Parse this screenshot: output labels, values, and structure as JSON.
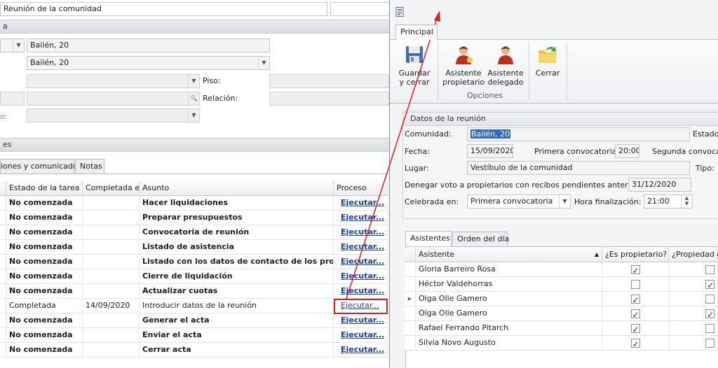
{
  "left": {
    "top_title": "Reunión de la comunidad",
    "section1_title": "a",
    "address1": "Bailén, 20",
    "address2": "Bailén, 20",
    "piso_label": "Piso:",
    "relacion_label": "Relación:",
    "cut_label": "o:",
    "section2_title": "es",
    "tabs": [
      "iones y comunicados",
      "Notas"
    ],
    "grid_headers": [
      "Estado de la tarea",
      "Completada el",
      "Asunto",
      "Proceso"
    ],
    "rows": [
      {
        "estado": "No comenzada",
        "fecha": "",
        "asunto": "Hacer liquidaciones",
        "proceso": "Ejecutar...",
        "bold": true
      },
      {
        "estado": "No comenzada",
        "fecha": "",
        "asunto": "Preparar presupuestos",
        "proceso": "Ejecutar...",
        "bold": true
      },
      {
        "estado": "No comenzada",
        "fecha": "",
        "asunto": "Convocatoria de reunión",
        "proceso": "Ejecutar...",
        "bold": true
      },
      {
        "estado": "No comenzada",
        "fecha": "",
        "asunto": "Listado de asistencia",
        "proceso": "Ejecutar...",
        "bold": true
      },
      {
        "estado": "No comenzada",
        "fecha": "",
        "asunto": "Listado con los datos de contacto de los propi...",
        "proceso": "Ejecutar...",
        "bold": true
      },
      {
        "estado": "No comenzada",
        "fecha": "",
        "asunto": "Cierre de liquidación",
        "proceso": "Ejecutar...",
        "bold": true
      },
      {
        "estado": "No comenzada",
        "fecha": "",
        "asunto": "Actualizar cuotas",
        "proceso": "Ejecutar...",
        "bold": true
      },
      {
        "estado": "Completada",
        "fecha": "14/09/2020",
        "asunto": "Introducir datos de la reunión",
        "proceso": "Ejecutar...",
        "bold": false
      },
      {
        "estado": "No comenzada",
        "fecha": "",
        "asunto": "Generar el acta",
        "proceso": "Ejecutar...",
        "bold": true
      },
      {
        "estado": "No comenzada",
        "fecha": "",
        "asunto": "Enviar el acta",
        "proceso": "Ejecutar...",
        "bold": true
      },
      {
        "estado": "No comenzada",
        "fecha": "",
        "asunto": "Cerrar acta",
        "proceso": "Ejecutar...",
        "bold": true
      }
    ]
  },
  "dialog": {
    "ribbon_tab": "Principal",
    "buttons": {
      "save": "Guardar\ny cerrar",
      "owner": "Asistente\npropietario",
      "delegate": "Asistente\ndelegado",
      "close": "Cerrar"
    },
    "group_label": "Opciones",
    "section_title": "Datos de la reunión",
    "comunidad_label": "Comunidad:",
    "comunidad_value": "Bailén, 20",
    "estado_label": "Estado:",
    "fecha_label": "Fecha:",
    "fecha_value": "15/09/2020",
    "primera_label": "Primera convocatoria:",
    "primera_value": "20:00",
    "segunda_label": "Segunda convocato",
    "lugar_label": "Lugar:",
    "lugar_value": "Vestíbulo de la comunidad",
    "tipo_label": "Tipo:",
    "denegar_label": "Denegar voto a propietarios con recibos pendientes anteriores a:",
    "denegar_value": "31/12/2020",
    "celebrada_label": "Celebrada en:",
    "celebrada_value": "Primera convocatoria",
    "hora_label": "Hora finalización:",
    "hora_value": "21:00",
    "tabs": [
      "Asistentes",
      "Orden del día"
    ],
    "att_headers": [
      "Asistente",
      "¿Es propietario?",
      "¿Propiedad de"
    ],
    "attendees": [
      {
        "name": "Gloria Barreiro Rosa",
        "owner": true,
        "prop": false
      },
      {
        "name": "Héctor Valdehorras",
        "owner": false,
        "prop": true
      },
      {
        "name": "Olga Olle Gamero",
        "owner": true,
        "prop": false
      },
      {
        "name": "Olga Olle Gamero",
        "owner": true,
        "prop": true
      },
      {
        "name": "Rafael Ferrando Pitarch",
        "owner": true,
        "prop": false
      },
      {
        "name": "Silvia Novo Augusto",
        "owner": true,
        "prop": false
      }
    ]
  }
}
